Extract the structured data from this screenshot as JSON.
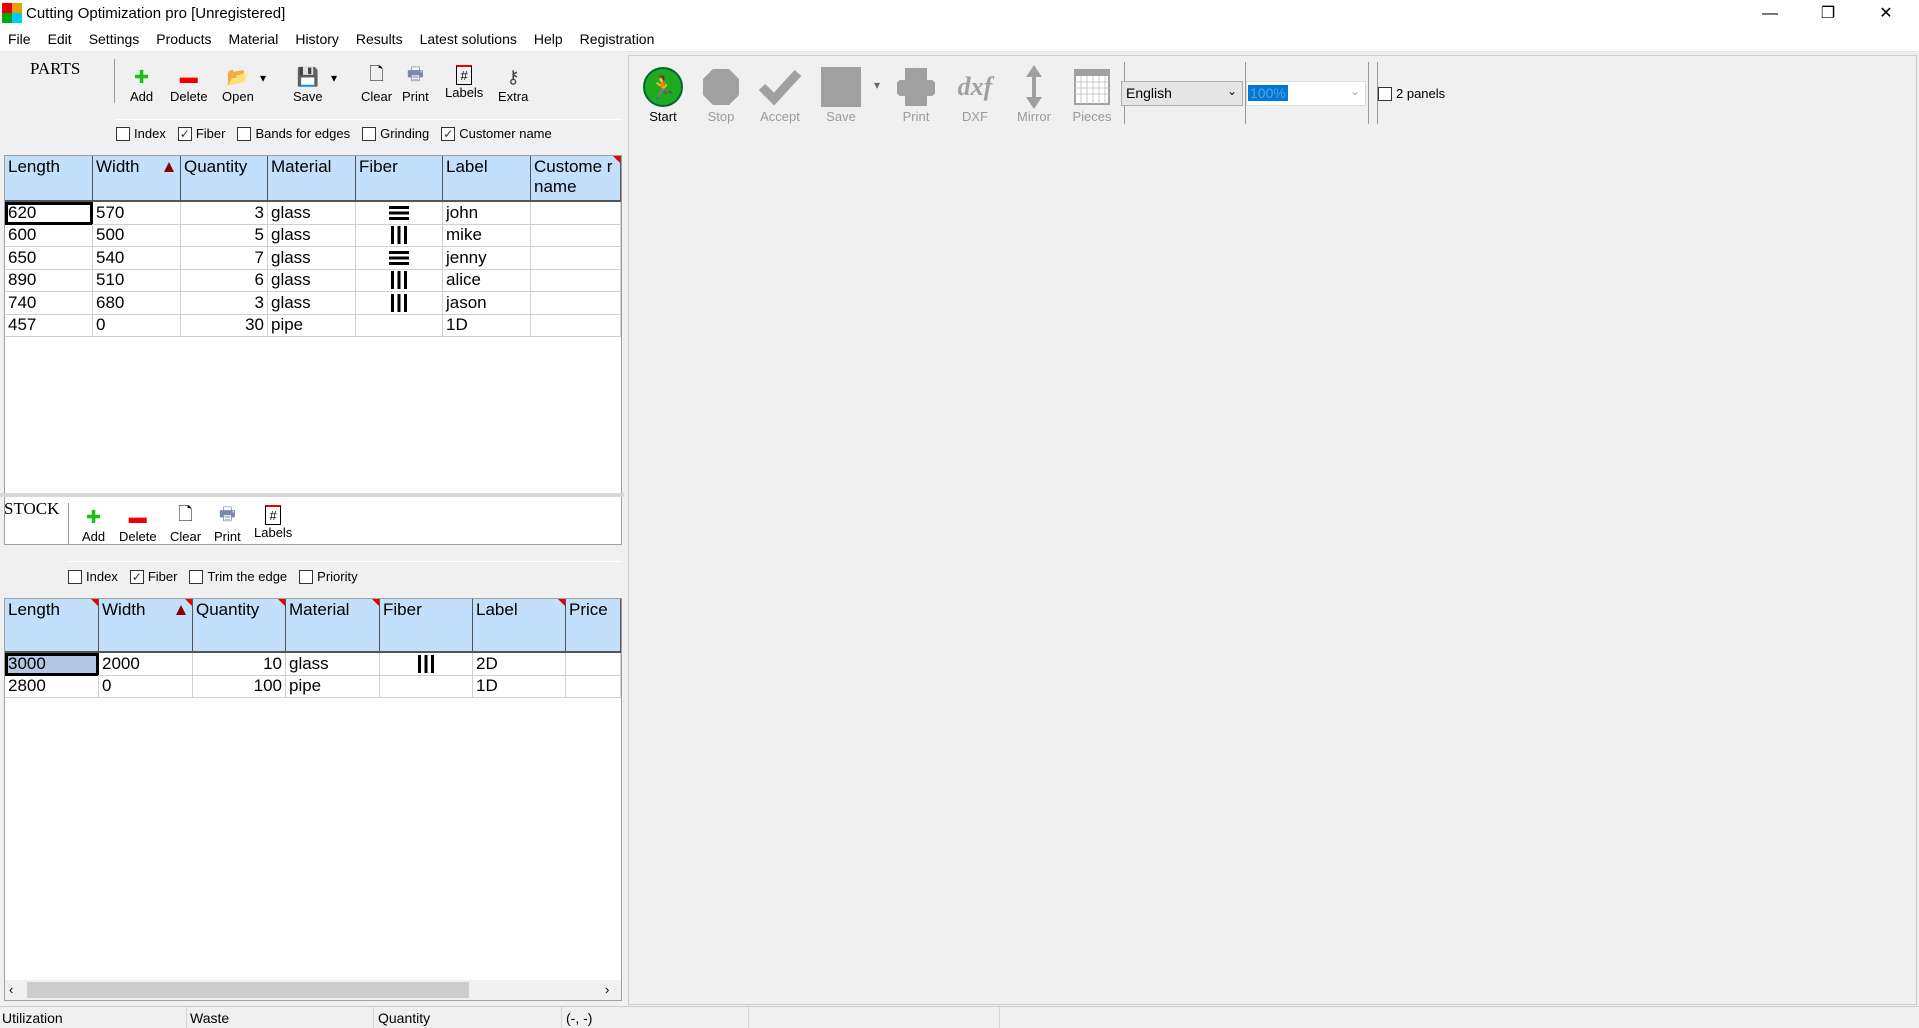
{
  "window": {
    "title": "Cutting Optimization pro [Unregistered]",
    "minimize": "—",
    "restore": "❐",
    "close": "✕"
  },
  "menu": [
    "File",
    "Edit",
    "Settings",
    "Products",
    "Material",
    "History",
    "Results",
    "Latest solutions",
    "Help",
    "Registration"
  ],
  "parts": {
    "label": "PARTS",
    "toolbar": [
      {
        "label": "Add",
        "icon": "plus-icon"
      },
      {
        "label": "Delete",
        "icon": "minus-icon"
      },
      {
        "label": "Open",
        "icon": "folder-icon"
      },
      {
        "label": "Save",
        "icon": "floppy-icon"
      },
      {
        "label": "Clear",
        "icon": "page-icon"
      },
      {
        "label": "Print",
        "icon": "printer-icon"
      },
      {
        "label": "Labels",
        "icon": "labels-icon"
      },
      {
        "label": "Extra",
        "icon": "key-icon"
      }
    ],
    "checkboxes": [
      {
        "label": "Index",
        "checked": false
      },
      {
        "label": "Fiber",
        "checked": true
      },
      {
        "label": "Bands for edges",
        "checked": false
      },
      {
        "label": "Grinding",
        "checked": false
      },
      {
        "label": "Customer name",
        "checked": true
      }
    ],
    "columns": [
      "Length",
      "Width",
      "Quantity",
      "Material",
      "Fiber",
      "Label",
      "Custome r name"
    ],
    "rows": [
      [
        "620",
        "570",
        "3",
        "glass",
        "horizontal",
        "john",
        ""
      ],
      [
        "600",
        "500",
        "5",
        "glass",
        "vertical",
        "mike",
        ""
      ],
      [
        "650",
        "540",
        "7",
        "glass",
        "horizontal",
        "jenny",
        ""
      ],
      [
        "890",
        "510",
        "6",
        "glass",
        "vertical",
        "alice",
        ""
      ],
      [
        "740",
        "680",
        "3",
        "glass",
        "vertical",
        "jason",
        ""
      ],
      [
        "457",
        "0",
        "30",
        "pipe",
        "",
        "1D",
        ""
      ]
    ]
  },
  "stock": {
    "label": "STOCK",
    "toolbar": [
      {
        "label": "Add",
        "icon": "plus-icon"
      },
      {
        "label": "Delete",
        "icon": "minus-icon"
      },
      {
        "label": "Clear",
        "icon": "page-icon"
      },
      {
        "label": "Print",
        "icon": "printer-icon"
      },
      {
        "label": "Labels",
        "icon": "labels-icon"
      }
    ],
    "checkboxes": [
      {
        "label": "Index",
        "checked": false
      },
      {
        "label": "Fiber",
        "checked": true
      },
      {
        "label": "Trim the edge",
        "checked": false
      },
      {
        "label": "Priority",
        "checked": false
      }
    ],
    "columns": [
      "Length",
      "Width",
      "Quantity",
      "Material",
      "Fiber",
      "Label",
      "Price"
    ],
    "rows": [
      [
        "3000",
        "2000",
        "10",
        "glass",
        "vertical",
        "2D",
        ""
      ],
      [
        "2800",
        "0",
        "100",
        "pipe",
        "",
        "1D",
        ""
      ]
    ]
  },
  "results_toolbar": {
    "buttons": [
      {
        "label": "Start",
        "icon": "start-runner-icon"
      },
      {
        "label": "Stop",
        "icon": "stop-icon"
      },
      {
        "label": "Accept",
        "icon": "check-icon"
      },
      {
        "label": "Save",
        "icon": "save-icon"
      },
      {
        "label": "Print",
        "icon": "printer-icon"
      },
      {
        "label": "DXF",
        "icon": "dxf-icon"
      },
      {
        "label": "Mirror",
        "icon": "mirror-icon"
      },
      {
        "label": "Pieces",
        "icon": "pieces-icon"
      }
    ],
    "dxf_glyph": "dxf",
    "language": "English",
    "zoom": "100%",
    "two_panels_label": "2 panels"
  },
  "status": [
    "Utilization",
    "Waste",
    "Quantity",
    "(-, -)"
  ],
  "colors": {
    "header": "#c2dffb",
    "selection": "#0078d7",
    "start": "#22aa22"
  }
}
